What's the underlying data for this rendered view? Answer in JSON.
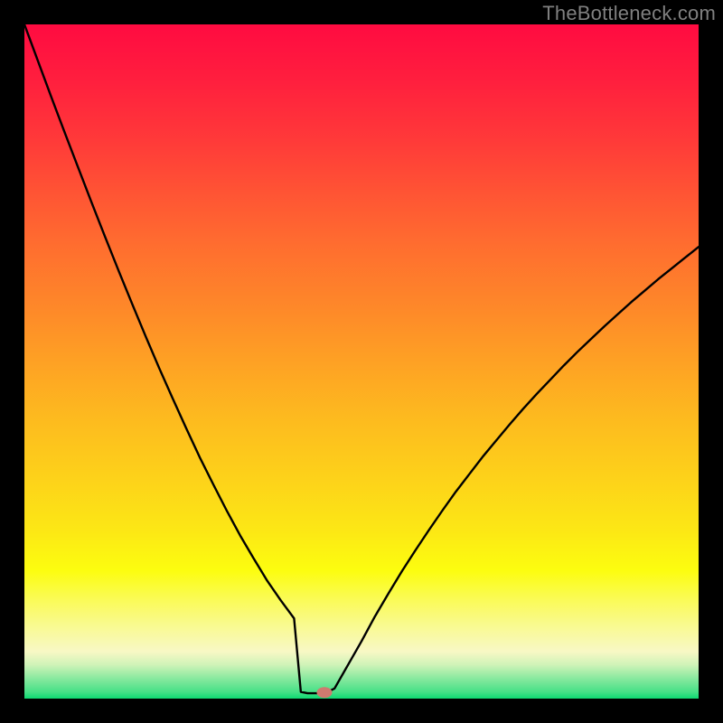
{
  "watermark": "TheBottleneck.com",
  "chart_data": {
    "type": "line",
    "title": "",
    "xlabel": "",
    "ylabel": "",
    "xlim": [
      0,
      100
    ],
    "ylim": [
      0,
      100
    ],
    "series": [
      {
        "name": "curve",
        "x": [
          0,
          2,
          4,
          6,
          8,
          10,
          12,
          14,
          16,
          18,
          20,
          22,
          24,
          26,
          28,
          30,
          32,
          34,
          36,
          38,
          40,
          41,
          42,
          43,
          44,
          45,
          46,
          48,
          50,
          52,
          54,
          56,
          58,
          60,
          62,
          64,
          66,
          68,
          70,
          72,
          74,
          76,
          78,
          80,
          82,
          84,
          86,
          88,
          90,
          92,
          94,
          96,
          98,
          100
        ],
        "y": [
          100,
          94.6,
          89.2,
          83.9,
          78.7,
          73.5,
          68.4,
          63.4,
          58.5,
          53.7,
          49.0,
          44.5,
          40.1,
          35.8,
          31.8,
          27.9,
          24.2,
          20.8,
          17.5,
          14.6,
          11.9,
          1.0,
          0.8,
          0.8,
          0.8,
          1.0,
          1.5,
          5.0,
          8.5,
          12.2,
          15.6,
          18.9,
          22.0,
          25.0,
          27.9,
          30.7,
          33.3,
          35.9,
          38.3,
          40.7,
          43.0,
          45.2,
          47.3,
          49.4,
          51.4,
          53.3,
          55.2,
          57.0,
          58.8,
          60.5,
          62.2,
          63.8,
          65.4,
          67.0
        ]
      }
    ],
    "marker": {
      "x": 44.5,
      "y": 0.9,
      "color": "#cf7a6f"
    },
    "background_gradient": {
      "stops": [
        {
          "offset": 0.0,
          "color": "#ff0b41"
        },
        {
          "offset": 0.08,
          "color": "#ff1e3e"
        },
        {
          "offset": 0.17,
          "color": "#ff3939"
        },
        {
          "offset": 0.25,
          "color": "#ff5434"
        },
        {
          "offset": 0.33,
          "color": "#ff6e2f"
        },
        {
          "offset": 0.42,
          "color": "#fe8829"
        },
        {
          "offset": 0.5,
          "color": "#fea124"
        },
        {
          "offset": 0.58,
          "color": "#fdb91f"
        },
        {
          "offset": 0.67,
          "color": "#fdd11a"
        },
        {
          "offset": 0.75,
          "color": "#fce715"
        },
        {
          "offset": 0.81,
          "color": "#fcfd0f"
        },
        {
          "offset": 0.85,
          "color": "#fafb52"
        },
        {
          "offset": 0.89,
          "color": "#f9fa8e"
        },
        {
          "offset": 0.93,
          "color": "#f8f8c5"
        },
        {
          "offset": 0.95,
          "color": "#cff3b8"
        },
        {
          "offset": 0.97,
          "color": "#89e99f"
        },
        {
          "offset": 0.99,
          "color": "#47e087"
        },
        {
          "offset": 1.0,
          "color": "#0ed972"
        }
      ]
    }
  }
}
